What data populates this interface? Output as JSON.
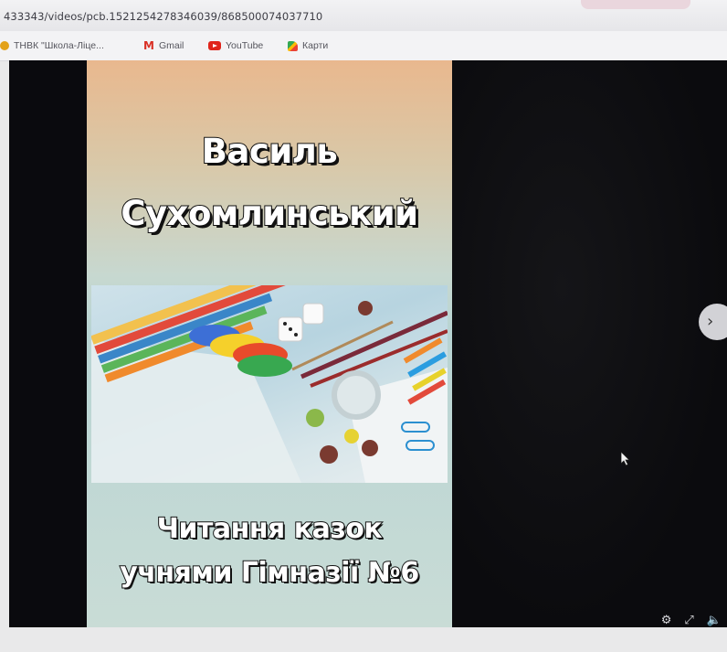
{
  "browser": {
    "url_text": "433343/videos/pcb.1521254278346039/868500074037710",
    "bookmarks": [
      {
        "label": "ТНВК \"Школа-Ліце...",
        "icon": "school-icon"
      },
      {
        "label": "Gmail",
        "icon": "gmail-icon"
      },
      {
        "label": "YouTube",
        "icon": "youtube-icon"
      },
      {
        "label": "Карти",
        "icon": "maps-icon"
      }
    ]
  },
  "video": {
    "title_line1": "Василь",
    "title_line2": "Сухомлинський",
    "caption_line1": "Читання казок",
    "caption_line2": "учнями Гімназії №6",
    "next_button_icon": "chevron-right-icon",
    "background_color": "#0a0a0e"
  },
  "icons": {
    "gmail_glyph": "M",
    "next_glyph": "›"
  }
}
